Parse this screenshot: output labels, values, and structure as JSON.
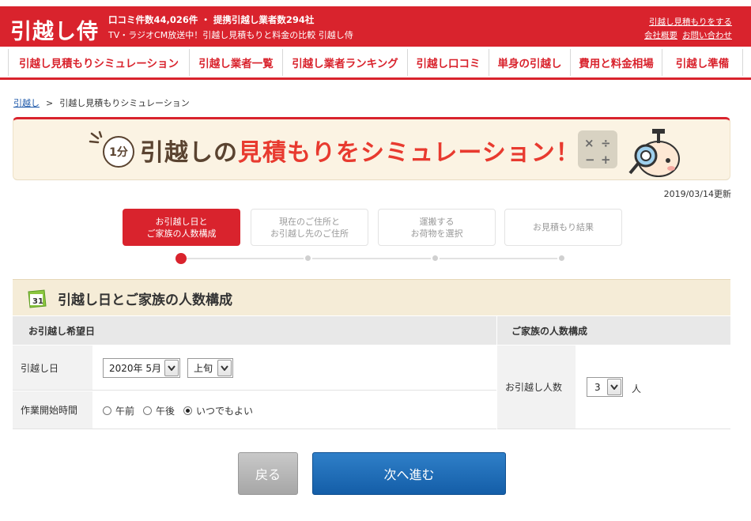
{
  "header": {
    "logo": "引越し侍",
    "tagline1": "口コミ件数44,026件 ・ 提携引越し業者数294社",
    "tagline2": "TV・ラジオCM放送中！引越し見積もりと料金の比較 引越し侍",
    "link_estimate": "引越し見積もりをする",
    "link_company": "会社概要",
    "link_contact": "お問い合わせ"
  },
  "nav": [
    {
      "label": "引越し見積もりシミュレーション"
    },
    {
      "label": "引越し業者一覧"
    },
    {
      "label": "引越し業者ランキング"
    },
    {
      "label": "引越し口コミ"
    },
    {
      "label": "単身の引越し"
    },
    {
      "label": "費用と料金相場"
    },
    {
      "label": "引越し準備"
    }
  ],
  "breadcrumb": {
    "home": "引越し",
    "sep": ">",
    "current": "引越し見積もりシミュレーション"
  },
  "banner": {
    "badge": "1分",
    "title_a": "引越しの",
    "title_hl": "見積もりをシミュレーション！"
  },
  "updated": "2019/03/14更新",
  "steps": [
    {
      "label": "お引越し日と\nご家族の人数構成"
    },
    {
      "label": "現在のご住所と\nお引越し先のご住所"
    },
    {
      "label": "運搬する\nお荷物を選択"
    },
    {
      "label": "お見積もり結果"
    }
  ],
  "section": {
    "title": "引越し日とご家族の人数構成",
    "col_date": "お引越し希望日",
    "col_family": "ご家族の人数構成",
    "label_date": "引越し日",
    "label_time": "作業開始時間",
    "month_value": "2020年 5月",
    "period_value": "上旬",
    "time_options": [
      "午前",
      "午後",
      "いつでもよい"
    ],
    "time_selected": "いつでもよい",
    "label_people": "お引越し人数",
    "people_value": "3",
    "people_unit": "人"
  },
  "buttons": {
    "back": "戻る",
    "next": "次へ進む"
  },
  "colors": {
    "brand_red": "#d9232d",
    "next_blue": "#1b6bb8"
  }
}
